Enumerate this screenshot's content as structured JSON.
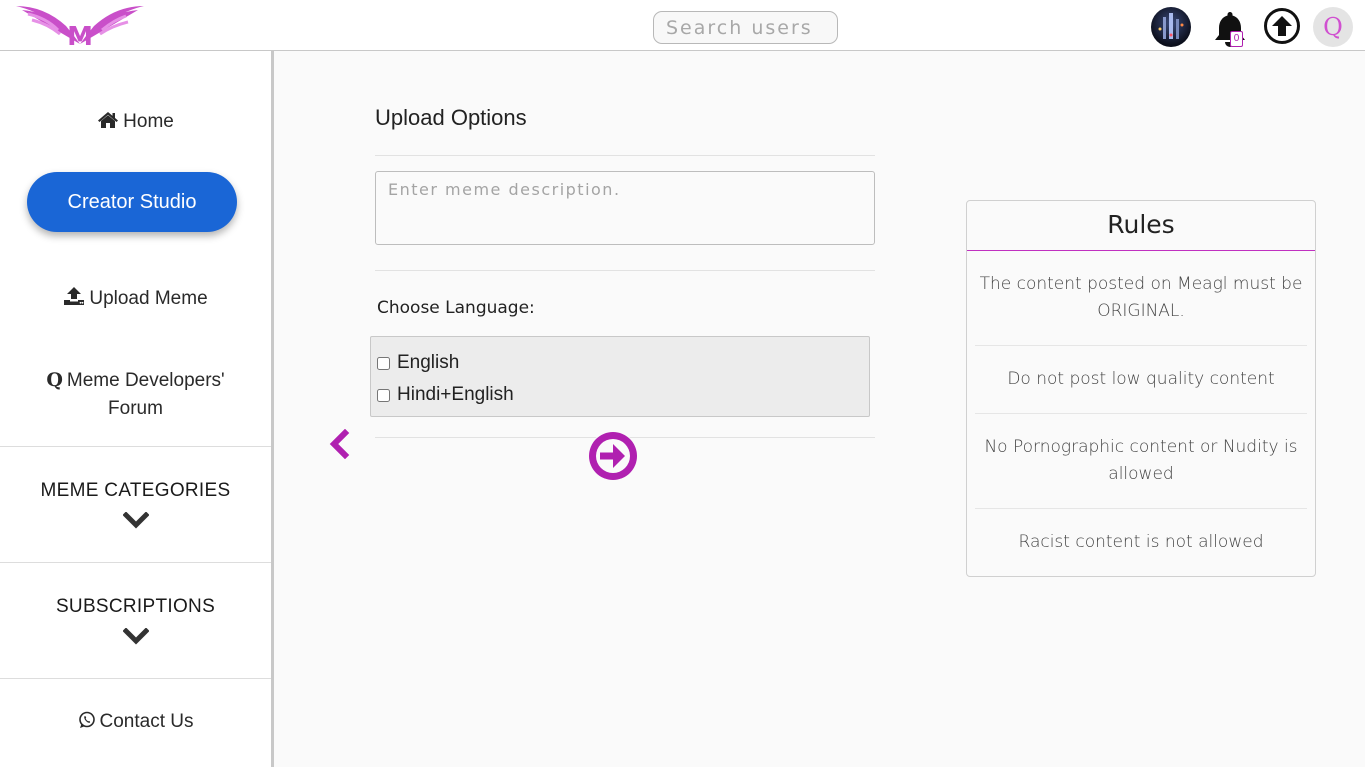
{
  "header": {
    "logo_text": "M",
    "search_placeholder": "Search users",
    "notification_count": "0",
    "profile_letter": "Q"
  },
  "sidebar": {
    "home": "Home",
    "creator_studio": "Creator Studio",
    "upload_meme": "Upload Meme",
    "forum_line1": "Meme Developers'",
    "forum_line2": "Forum",
    "categories": "MEME CATEGORIES",
    "subscriptions": "SUBSCRIPTIONS",
    "contact": "Contact Us"
  },
  "upload": {
    "title": "Upload Options",
    "description_placeholder": "Enter meme description.",
    "language_label": "Choose Language:",
    "languages": [
      "English",
      "Hindi+English"
    ]
  },
  "rules": {
    "title": "Rules",
    "items": [
      "The content posted on Meagl must be ORIGINAL.",
      "Do not post low quality content",
      "No Pornographic content or Nudity is allowed",
      "Racist content is not allowed"
    ]
  },
  "colors": {
    "accent": "#b020b0",
    "primary_button": "#1a66d6"
  }
}
